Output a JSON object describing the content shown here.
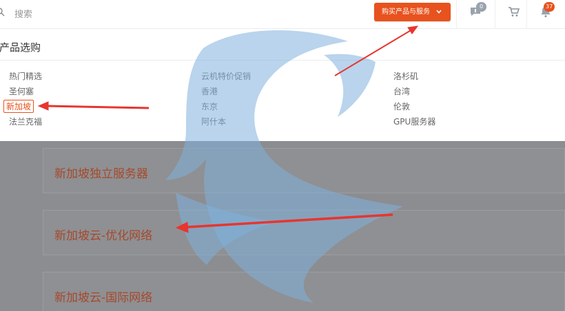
{
  "topbar": {
    "search_placeholder": "搜索",
    "buy_button_label": "购买产品与服务",
    "messages_count": "0",
    "notifications_count": "37"
  },
  "products": {
    "title": "产品选购",
    "menu_items": [
      {
        "label": "热门精选"
      },
      {
        "label": "圣何塞"
      },
      {
        "label": "新加坡"
      },
      {
        "label": "法兰克福"
      },
      {
        "label": "云机特价促销"
      },
      {
        "label": "香港"
      },
      {
        "label": "东京"
      },
      {
        "label": "阿什本"
      },
      {
        "label": "洛杉矶"
      },
      {
        "label": "台湾"
      },
      {
        "label": "伦敦"
      },
      {
        "label": "GPU服务器"
      }
    ],
    "active_item": "新加坡"
  },
  "cards": [
    {
      "title": "新加坡独立服务器"
    },
    {
      "title": "新加坡云-优化网络"
    },
    {
      "title": "新加坡云-国际网络"
    }
  ],
  "colors": {
    "accent": "#e8521e",
    "annotation_arrow": "#e8352f",
    "watermark": "#7fb0dc",
    "overlay": "#8c8d90",
    "card_title": "#a5492c"
  }
}
